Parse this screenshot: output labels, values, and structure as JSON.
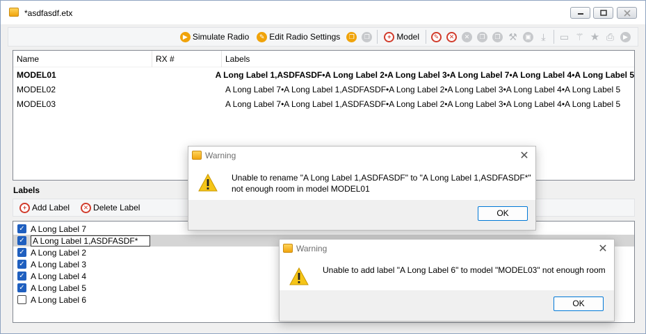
{
  "window": {
    "title": "*asdfasdf.etx"
  },
  "toolbar": {
    "simulate_radio": "Simulate Radio",
    "edit_radio_settings": "Edit Radio Settings",
    "model": "Model"
  },
  "models": {
    "columns": [
      "Name",
      "RX #",
      "Labels"
    ],
    "rows": [
      {
        "name": "MODEL01",
        "rx": "",
        "labels": "A Long Label 1,ASDFASDF•A Long Label 2•A Long Label 3•A Long Label 7•A Long Label 4•A Long Label 5"
      },
      {
        "name": "MODEL02",
        "rx": "",
        "labels": "A Long Label 7•A Long Label 1,ASDFASDF•A Long Label 2•A Long Label 3•A Long Label 4•A Long Label 5"
      },
      {
        "name": "MODEL03",
        "rx": "",
        "labels": "A Long Label 7•A Long Label 1,ASDFASDF•A Long Label 2•A Long Label 3•A Long Label 4•A Long Label 5"
      }
    ]
  },
  "labels_section": {
    "title": "Labels",
    "add_label": "Add Label",
    "delete_label": "Delete Label",
    "items": [
      {
        "text": "A Long Label 7",
        "checked": true
      },
      {
        "text": "A Long Label 1,ASDFASDF*",
        "checked": true
      },
      {
        "text": "A Long Label 2",
        "checked": true
      },
      {
        "text": "A Long Label 3",
        "checked": true
      },
      {
        "text": "A Long Label 4",
        "checked": true
      },
      {
        "text": "A Long Label 5",
        "checked": true
      },
      {
        "text": "A Long Label 6",
        "checked": false
      }
    ]
  },
  "dialog1": {
    "title": "Warning",
    "line1": "Unable to rename \"A Long Label 1,ASDFASDF\" to \"A Long Label 1,ASDFASDF*\"",
    "line2": "not enough room in model MODEL01",
    "ok": "OK"
  },
  "dialog2": {
    "title": "Warning",
    "message": "Unable to add label \"A Long Label 6\" to model \"MODEL03\" not enough room",
    "ok": "OK"
  },
  "colors": {
    "accent": "#0078d7",
    "checkbox": "#1f5fbf",
    "warning": "#f5c518"
  }
}
